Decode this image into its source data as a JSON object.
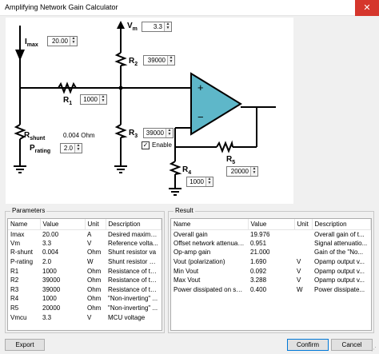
{
  "window": {
    "title": "Amplifying Network Gain Calculator",
    "close_glyph": "✕"
  },
  "schematic": {
    "imax": {
      "label": "I",
      "sub": "max",
      "value": "20.00"
    },
    "vm": {
      "label": "V",
      "sub": "m",
      "value": "3.3"
    },
    "r1": {
      "label": "R",
      "sub": "1",
      "value": "1000"
    },
    "r2": {
      "label": "R",
      "sub": "2",
      "value": "39000"
    },
    "r3": {
      "label": "R",
      "sub": "3",
      "value": "39000"
    },
    "r4": {
      "label": "R",
      "sub": "4",
      "value": "1000"
    },
    "r5": {
      "label": "R",
      "sub": "5",
      "value": "20000"
    },
    "rshunt": {
      "label": "R",
      "sub": "shunt",
      "value": "0.004 Ohm"
    },
    "prating": {
      "label": "P",
      "sub": "rating",
      "value": "2.0"
    },
    "enable": {
      "label": "Enable",
      "checked": "✓"
    },
    "opamp": {
      "plus": "+",
      "minus": "−"
    }
  },
  "parameters": {
    "title": "Parameters",
    "columns": [
      "Name",
      "Value",
      "Unit",
      "Description"
    ],
    "rows": [
      [
        "Imax",
        "20.00",
        "A",
        "Desired maximu..."
      ],
      [
        "Vm",
        "3.3",
        "V",
        "Reference volta..."
      ],
      [
        "R-shunt",
        "0.004",
        "Ohm",
        "Shunt resistor va"
      ],
      [
        "P-rating",
        "2.0",
        "W",
        "Shunt resistor m..."
      ],
      [
        "R1",
        "1000",
        "Ohm",
        "Resistance of th..."
      ],
      [
        "R2",
        "39000",
        "Ohm",
        "Resistance of th..."
      ],
      [
        "R3",
        "39000",
        "Ohm",
        "Resistance of th..."
      ],
      [
        "R4",
        "1000",
        "Ohm",
        "\"Non-inverting\" ..."
      ],
      [
        "R5",
        "20000",
        "Ohm",
        "\"Non-inverting\" ..."
      ],
      [
        "Vmcu",
        "3.3",
        "V",
        "MCU voltage"
      ]
    ]
  },
  "result": {
    "title": "Result",
    "columns": [
      "Name",
      "Value",
      "Unit",
      "Description"
    ],
    "rows": [
      [
        "Overall gain",
        "19.976",
        "",
        "Overall gain of t..."
      ],
      [
        "Offset network attenuation",
        "0.951",
        "",
        "Signal attenuatio..."
      ],
      [
        "Op-amp gain",
        "21.000",
        "",
        "Gain of the \"No..."
      ],
      [
        "Vout (polarization)",
        "1.690",
        "V",
        "Opamp output v..."
      ],
      [
        "Min Vout",
        "0.092",
        "V",
        "Opamp output v..."
      ],
      [
        "Max Vout",
        "3.288",
        "V",
        "Opamp output v..."
      ],
      [
        "Power dissipated on shunt",
        "0.400",
        "W",
        "Power dissipate..."
      ]
    ]
  },
  "buttons": {
    "export": "Export",
    "confirm": "Confirm",
    "cancel": "Cancel"
  },
  "colors": {
    "opamp_fill": "#5eb7c9",
    "close_bg": "#d5362c",
    "accent": "#0078d7"
  }
}
